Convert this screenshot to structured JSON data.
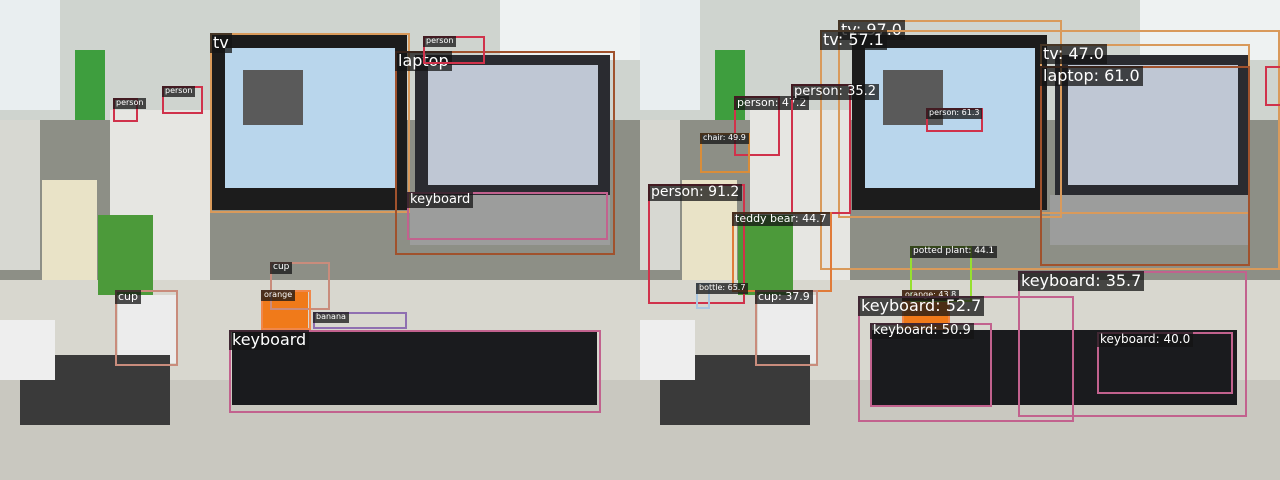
{
  "colors": {
    "tv": "#d99a5b",
    "laptop": "#a0522d",
    "keyboard": "#c2628e",
    "person": "#d0324b",
    "cup": "#c98c7c",
    "orange": "#f0874a",
    "banana": "#8f6fb1",
    "chair": "#d98d3a",
    "teddy_bear": "#e07b39",
    "potted_plant": "#96e030",
    "bottle": "#a9c7e3"
  },
  "left_panel": {
    "labels": {
      "tv": "tv",
      "laptop": "laptop",
      "keyboard_top": "keyboard",
      "keyboard_main": "keyboard",
      "person_top": "person",
      "person_mid": "person",
      "person_left": "person",
      "cup_small": "cup",
      "cup_big": "cup",
      "orange": "orange",
      "banana": "banana"
    }
  },
  "right_panel": {
    "labels": {
      "tv_97": "tv: 97.0",
      "tv_57": "tv: 57.1",
      "tv_47": "tv: 47.0",
      "laptop_61": "laptop: 61.0",
      "person_47": "person: 47.2",
      "person_35": "person: 35.2",
      "person_61": "person: 61.3",
      "person_91": "person: 91.2",
      "chair_49": "chair: 49.9",
      "teddy_44": "teddy bear: 44.7",
      "potted_44": "potted plant: 44.1",
      "bottle_65": "bottle: 65.7",
      "cup_37": "cup: 37.9",
      "orange_43": "orange: 43.8",
      "keyboard_52": "keyboard: 52.7",
      "keyboard_50": "keyboard: 50.9",
      "keyboard_35": "keyboard: 35.7",
      "keyboard_40": "keyboard: 40.0"
    }
  }
}
